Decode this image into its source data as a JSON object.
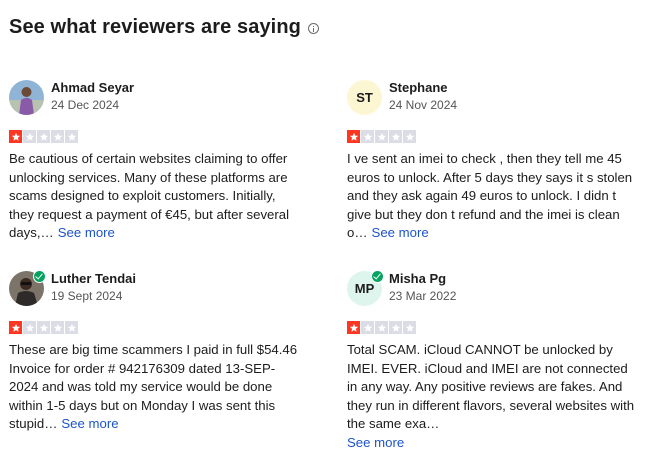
{
  "header": {
    "title": "See what reviewers are saying"
  },
  "colors": {
    "star_red": "#ff3722",
    "star_empty": "#dcdce6",
    "link_blue": "#1d54c9",
    "verified_green": "#04a35f"
  },
  "reviews": [
    {
      "name": "Ahmad Seyar",
      "date": "24 Dec 2024",
      "rating": 1,
      "max_rating": 5,
      "avatar": "photo",
      "verified": false,
      "text": "Be cautious of certain websites claiming to offer unlocking services. Many of these platforms are scams designed to exploit customers. Initially, they request a payment of €45, but after several days,…",
      "see_more": "See more"
    },
    {
      "name": "Stephane",
      "date": "24 Nov 2024",
      "rating": 1,
      "max_rating": 5,
      "avatar": "initials",
      "initials": "ST",
      "verified": false,
      "text": "I ve sent an imei to check , then they tell me 45 euros to unlock. After 5 days they says it s stolen and they ask again 49 euros to unlock. I didn t give but they don t refund and the imei is clean o…",
      "see_more": "See more"
    },
    {
      "name": "Luther Tendai",
      "date": "19 Sept 2024",
      "rating": 1,
      "max_rating": 5,
      "avatar": "photo",
      "verified": true,
      "text": "These are big time scammers I paid in full $54.46 Invoice for order # 942176309 dated 13-SEP-2024 and was told my service would be done within 1-5 days but on Monday I was sent this stupid…",
      "see_more": "See more"
    },
    {
      "name": "Misha Pg",
      "date": "23 Mar 2022",
      "rating": 1,
      "max_rating": 5,
      "avatar": "initials",
      "initials": "MP",
      "verified": true,
      "text": "Total SCAM. iCloud CANNOT be unlocked by IMEI. EVER. iCloud and IMEI are not connected in any way. Any positive reviews are fakes. And they run in different flavors, several websites with the same exa…",
      "see_more": "See more"
    }
  ]
}
